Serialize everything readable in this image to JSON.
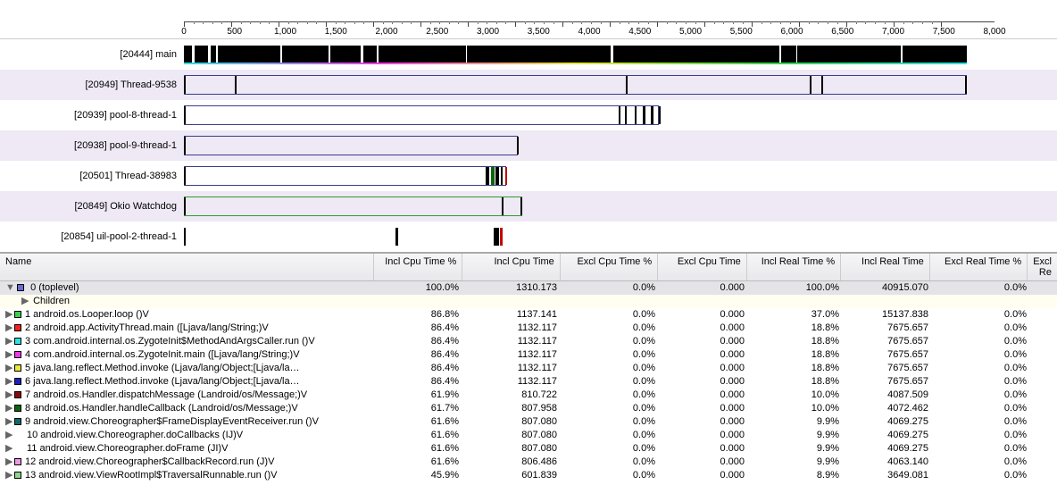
{
  "ruler": {
    "ticks": [
      0,
      500,
      1000,
      1500,
      2000,
      2500,
      3000,
      3500,
      4000,
      4500,
      5000,
      5500,
      6000,
      6500,
      7000,
      7500,
      8000
    ],
    "labels": [
      "0",
      "500",
      "1,000",
      "1,500",
      "2,000",
      "2,500",
      "3,000",
      "3,500",
      "4,000",
      "4,500",
      "5,000",
      "5,500",
      "6,000",
      "6,500",
      "7,000",
      "7,500",
      "8,000"
    ],
    "max": 8000
  },
  "threads": [
    {
      "label": "[20444] main",
      "alt": false
    },
    {
      "label": "[20949] Thread-9538",
      "alt": true
    },
    {
      "label": "[20939] pool-8-thread-1",
      "alt": false
    },
    {
      "label": "[20938] pool-9-thread-1",
      "alt": true
    },
    {
      "label": "[20501] Thread-38983",
      "alt": false
    },
    {
      "label": "[20849] Okio Watchdog",
      "alt": true
    },
    {
      "label": "[20854] uil-pool-2-thread-1",
      "alt": false
    }
  ],
  "table": {
    "headers": {
      "name": "Name",
      "iclp": "Incl Cpu Time %",
      "icl": "Incl Cpu Time",
      "exclp": "Excl Cpu Time %",
      "excl": "Excl Cpu Time",
      "irtp": "Incl Real Time %",
      "irt": "Incl Real Time",
      "ertp": "Excl Real Time %",
      "ert": "Excl Re"
    },
    "top": {
      "name": "0 (toplevel)",
      "iclp": "100.0%",
      "icl": "1310.173",
      "exclp": "0.0%",
      "excl": "0.000",
      "irtp": "100.0%",
      "irt": "40915.070",
      "ertp": "0.0%",
      "color": "#6a6ad0"
    },
    "children_label": "Children",
    "rows": [
      {
        "color": "#36d24b",
        "name": "1 android.os.Looper.loop ()V",
        "iclp": "86.8%",
        "icl": "1137.141",
        "exclp": "0.0%",
        "excl": "0.000",
        "irtp": "37.0%",
        "irt": "15137.838",
        "ertp": "0.0%"
      },
      {
        "color": "#ff1f1f",
        "name": "2 android.app.ActivityThread.main ([Ljava/lang/String;)V",
        "iclp": "86.4%",
        "icl": "1132.117",
        "exclp": "0.0%",
        "excl": "0.000",
        "irtp": "18.8%",
        "irt": "7675.657",
        "ertp": "0.0%"
      },
      {
        "color": "#2fe0e0",
        "name": "3 com.android.internal.os.ZygoteInit$MethodAndArgsCaller.run ()V",
        "iclp": "86.4%",
        "icl": "1132.117",
        "exclp": "0.0%",
        "excl": "0.000",
        "irtp": "18.8%",
        "irt": "7675.657",
        "ertp": "0.0%"
      },
      {
        "color": "#f339e6",
        "name": "4 com.android.internal.os.ZygoteInit.main ([Ljava/lang/String;)V",
        "iclp": "86.4%",
        "icl": "1132.117",
        "exclp": "0.0%",
        "excl": "0.000",
        "irtp": "18.8%",
        "irt": "7675.657",
        "ertp": "0.0%"
      },
      {
        "color": "#e8e83a",
        "name": "5 java.lang.reflect.Method.invoke (Ljava/lang/Object;[Ljava/la…",
        "iclp": "86.4%",
        "icl": "1132.117",
        "exclp": "0.0%",
        "excl": "0.000",
        "irtp": "18.8%",
        "irt": "7675.657",
        "ertp": "0.0%"
      },
      {
        "color": "#1f1fc0",
        "name": "6 java.lang.reflect.Method.invoke (Ljava/lang/Object;[Ljava/la…",
        "iclp": "86.4%",
        "icl": "1132.117",
        "exclp": "0.0%",
        "excl": "0.000",
        "irtp": "18.8%",
        "irt": "7675.657",
        "ertp": "0.0%"
      },
      {
        "color": "#8a0b0b",
        "name": "7 android.os.Handler.dispatchMessage (Landroid/os/Message;)V",
        "iclp": "61.9%",
        "icl": "810.722",
        "exclp": "0.0%",
        "excl": "0.000",
        "irtp": "10.0%",
        "irt": "4087.509",
        "ertp": "0.0%"
      },
      {
        "color": "#0b660b",
        "name": "8 android.os.Handler.handleCallback (Landroid/os/Message;)V",
        "iclp": "61.7%",
        "icl": "807.958",
        "exclp": "0.0%",
        "excl": "0.000",
        "irtp": "10.0%",
        "irt": "4072.462",
        "ertp": "0.0%"
      },
      {
        "color": "#0d6a6d",
        "name": "9 android.view.Choreographer$FrameDisplayEventReceiver.run ()V",
        "iclp": "61.6%",
        "icl": "807.080",
        "exclp": "0.0%",
        "excl": "0.000",
        "irtp": "9.9%",
        "irt": "4069.275",
        "ertp": "0.0%"
      },
      {
        "color": "",
        "name": "10 android.view.Choreographer.doCallbacks (IJ)V",
        "iclp": "61.6%",
        "icl": "807.080",
        "exclp": "0.0%",
        "excl": "0.000",
        "irtp": "9.9%",
        "irt": "4069.275",
        "ertp": "0.0%"
      },
      {
        "color": "",
        "name": "11 android.view.Choreographer.doFrame (JI)V",
        "iclp": "61.6%",
        "icl": "807.080",
        "exclp": "0.0%",
        "excl": "0.000",
        "irtp": "9.9%",
        "irt": "4069.275",
        "ertp": "0.0%"
      },
      {
        "color": "#e99be0",
        "name": "12 android.view.Choreographer$CallbackRecord.run (J)V",
        "iclp": "61.6%",
        "icl": "806.486",
        "exclp": "0.0%",
        "excl": "0.000",
        "irtp": "9.9%",
        "irt": "4063.140",
        "ertp": "0.0%"
      },
      {
        "color": "#8bd68b",
        "name": "13 android.view.ViewRootImpl$TraversalRunnable.run ()V",
        "iclp": "45.9%",
        "icl": "601.839",
        "exclp": "0.0%",
        "excl": "0.000",
        "irtp": "8.9%",
        "irt": "3649.081",
        "ertp": "0.0%"
      }
    ]
  }
}
